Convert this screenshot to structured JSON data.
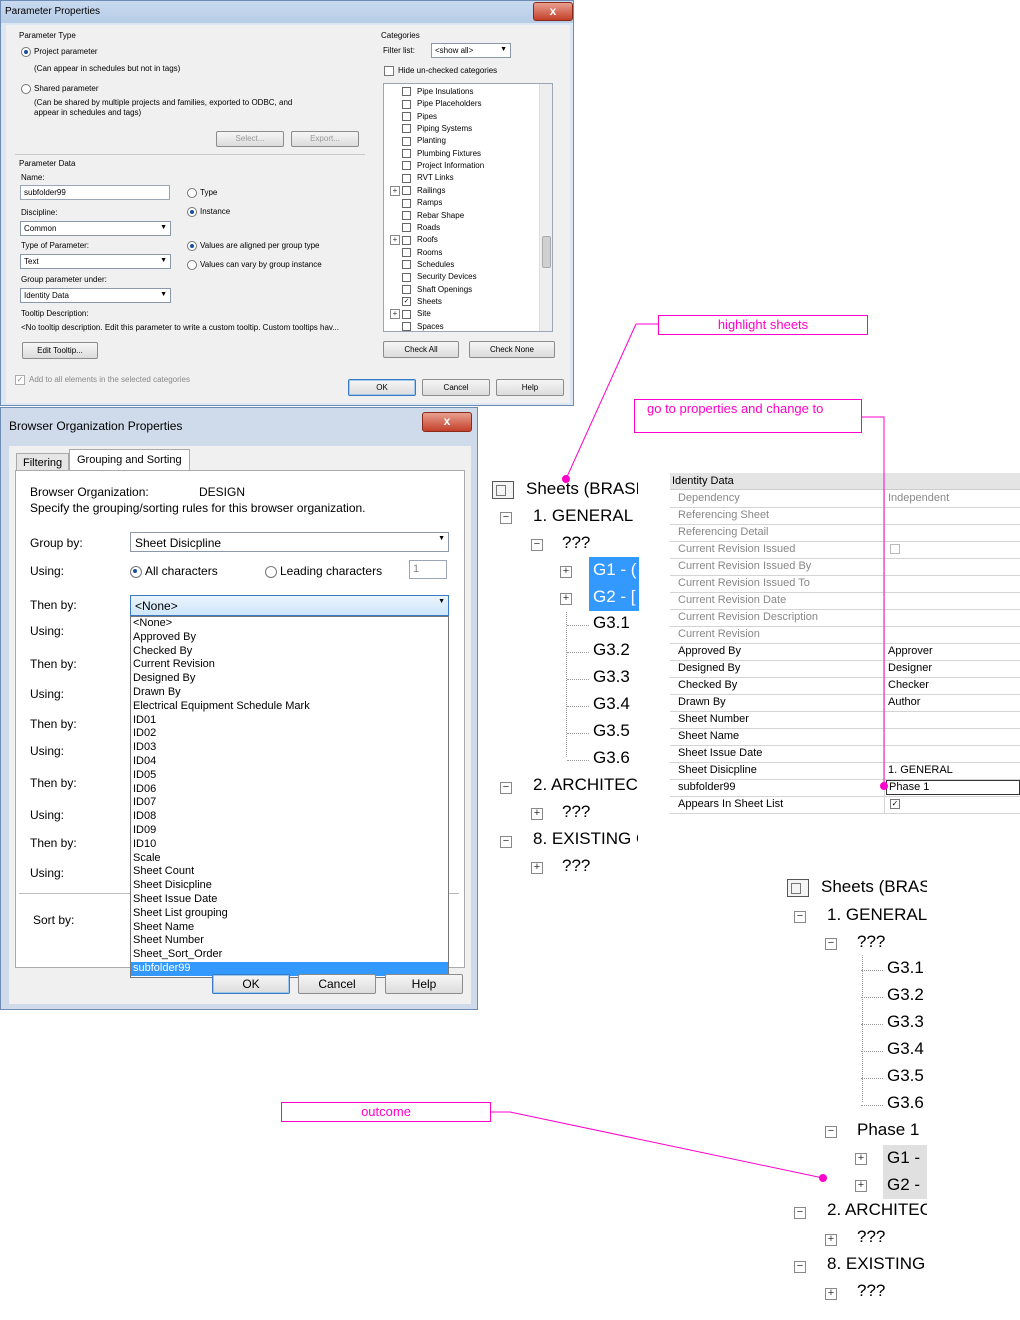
{
  "param_dialog": {
    "title": "Parameter Properties",
    "close": "x",
    "param_type_label": "Parameter Type",
    "project_param": "Project parameter",
    "project_desc": "(Can appear in schedules but not in tags)",
    "shared_param": "Shared parameter",
    "shared_desc1": "(Can be shared by multiple projects and families, exported to ODBC, and",
    "shared_desc2": "appear in schedules and tags)",
    "select_btn": "Select...",
    "export_btn": "Export...",
    "param_data_label": "Parameter Data",
    "name_label": "Name:",
    "name_value": "subfolder99",
    "type_radio": "Type",
    "instance_radio": "Instance",
    "discipline_label": "Discipline:",
    "discipline_value": "Common",
    "type_of_param_label": "Type of Parameter:",
    "type_of_param_value": "Text",
    "values_aligned": "Values are aligned per group type",
    "values_vary": "Values can vary by group instance",
    "group_under_label": "Group parameter under:",
    "group_under_value": "Identity Data",
    "tooltip_label": "Tooltip Description:",
    "tooltip_text": "<No tooltip description. Edit this parameter to write a custom tooltip. Custom tooltips hav...",
    "edit_tooltip": "Edit Tooltip...",
    "add_all": "Add to all elements in the selected categories",
    "categories_label": "Categories",
    "filter_label": "Filter list:",
    "filter_value": "<show all>",
    "hide_unchecked": "Hide un-checked categories",
    "categories": [
      {
        "name": "Pipe Insulations",
        "checked": false,
        "expand": false
      },
      {
        "name": "Pipe Placeholders",
        "checked": false,
        "expand": false
      },
      {
        "name": "Pipes",
        "checked": false,
        "expand": false
      },
      {
        "name": "Piping Systems",
        "checked": false,
        "expand": false
      },
      {
        "name": "Planting",
        "checked": false,
        "expand": false
      },
      {
        "name": "Plumbing Fixtures",
        "checked": false,
        "expand": false
      },
      {
        "name": "Project Information",
        "checked": false,
        "expand": false
      },
      {
        "name": "RVT Links",
        "checked": false,
        "expand": false
      },
      {
        "name": "Railings",
        "checked": false,
        "expand": true
      },
      {
        "name": "Ramps",
        "checked": false,
        "expand": false
      },
      {
        "name": "Rebar Shape",
        "checked": false,
        "expand": false
      },
      {
        "name": "Roads",
        "checked": false,
        "expand": false
      },
      {
        "name": "Roofs",
        "checked": false,
        "expand": true
      },
      {
        "name": "Rooms",
        "checked": false,
        "expand": false
      },
      {
        "name": "Schedules",
        "checked": false,
        "expand": false
      },
      {
        "name": "Security Devices",
        "checked": false,
        "expand": false
      },
      {
        "name": "Shaft Openings",
        "checked": false,
        "expand": false
      },
      {
        "name": "Sheets",
        "checked": true,
        "expand": false
      },
      {
        "name": "Site",
        "checked": false,
        "expand": true
      },
      {
        "name": "Spaces",
        "checked": false,
        "expand": false
      }
    ],
    "check_all": "Check All",
    "check_none": "Check None",
    "ok": "OK",
    "cancel": "Cancel",
    "help": "Help"
  },
  "browser_dialog": {
    "title": "Browser Organization Properties",
    "close": "x",
    "tab_filtering": "Filtering",
    "tab_grouping": "Grouping and Sorting",
    "org_label": "Browser Organization:",
    "org_value": "DESIGN",
    "specify": "Specify the grouping/sorting rules for this browser organization.",
    "group_by": "Group by:",
    "group_by_value": "Sheet Disicpline",
    "using": "Using:",
    "all_chars": "All characters",
    "leading_chars": "Leading characters",
    "leading_count": "1",
    "then_by": "Then by:",
    "then_by_value": "<None>",
    "sort_by": "Sort by:",
    "options": [
      "<None>",
      "Approved By",
      "Checked By",
      "Current Revision",
      "Designed By",
      "Drawn By",
      "Electrical Equipment Schedule Mark",
      "ID01",
      "ID02",
      "ID03",
      "ID04",
      "ID05",
      "ID06",
      "ID07",
      "ID08",
      "ID09",
      "ID10",
      "Scale",
      "Sheet Count",
      "Sheet Disicpline",
      "Sheet Issue Date",
      "Sheet List grouping",
      "Sheet Name",
      "Sheet Number",
      "Sheet_Sort_Order",
      "subfolder99"
    ],
    "ok": "OK",
    "cancel": "Cancel",
    "help": "Help"
  },
  "tree1": {
    "root": "Sheets (BRASH",
    "g1": "1.  GENERAL",
    "unknown": "???",
    "sel1": "G1 - (",
    "sel2": "G2 - [",
    "sheets": [
      "G3.1",
      "G3.2",
      "G3.3",
      "G3.4",
      "G3.5",
      "G3.6"
    ],
    "g2": "2.  ARCHITEC",
    "g8": "8. EXISTING C"
  },
  "tree2": {
    "root": "Sheets (BRAS",
    "g1": "1.  GENERAL",
    "unknown": "???",
    "sheets": [
      "G3.1",
      "G3.2",
      "G3.3",
      "G3.4",
      "G3.5",
      "G3.6"
    ],
    "phase": "Phase 1",
    "sel1": "G1 -",
    "sel2": "G2 -",
    "g2": "2.  ARCHITEC",
    "g8": "8. EXISTING C"
  },
  "properties": {
    "header": "Identity Data",
    "rows": [
      {
        "k": "Dependency",
        "v": "Independent",
        "gray": true
      },
      {
        "k": "Referencing Sheet",
        "v": "",
        "gray": true
      },
      {
        "k": "Referencing Detail",
        "v": "",
        "gray": true
      },
      {
        "k": "Current Revision Issued",
        "v": "",
        "gray": true,
        "check": true
      },
      {
        "k": "Current Revision Issued By",
        "v": "",
        "gray": true
      },
      {
        "k": "Current Revision Issued To",
        "v": "",
        "gray": true
      },
      {
        "k": "Current Revision Date",
        "v": "",
        "gray": true
      },
      {
        "k": "Current Revision Description",
        "v": "",
        "gray": true
      },
      {
        "k": "Current Revision",
        "v": "",
        "gray": true
      },
      {
        "k": "Approved By",
        "v": "Approver",
        "gray": false
      },
      {
        "k": "Designed By",
        "v": "Designer",
        "gray": false
      },
      {
        "k": "Checked By",
        "v": "Checker",
        "gray": false
      },
      {
        "k": "Drawn By",
        "v": "Author",
        "gray": false
      },
      {
        "k": "Sheet Number",
        "v": "",
        "gray": false
      },
      {
        "k": "Sheet Name",
        "v": "",
        "gray": false
      },
      {
        "k": "Sheet Issue Date",
        "v": "",
        "gray": false
      },
      {
        "k": "Sheet Disicpline",
        "v": "1.  GENERAL",
        "gray": false
      },
      {
        "k": "subfolder99",
        "v": "Phase 1",
        "gray": false,
        "edit": true
      },
      {
        "k": "Appears In Sheet List",
        "v": "",
        "gray": false,
        "check": true,
        "checked": true
      }
    ]
  },
  "annotations": {
    "highlight": "highlight sheets",
    "goto": "go to properties and change to",
    "outcome": "outcome"
  },
  "colors": {
    "annotation": "#ff00cc",
    "selection": "#3399ff"
  }
}
